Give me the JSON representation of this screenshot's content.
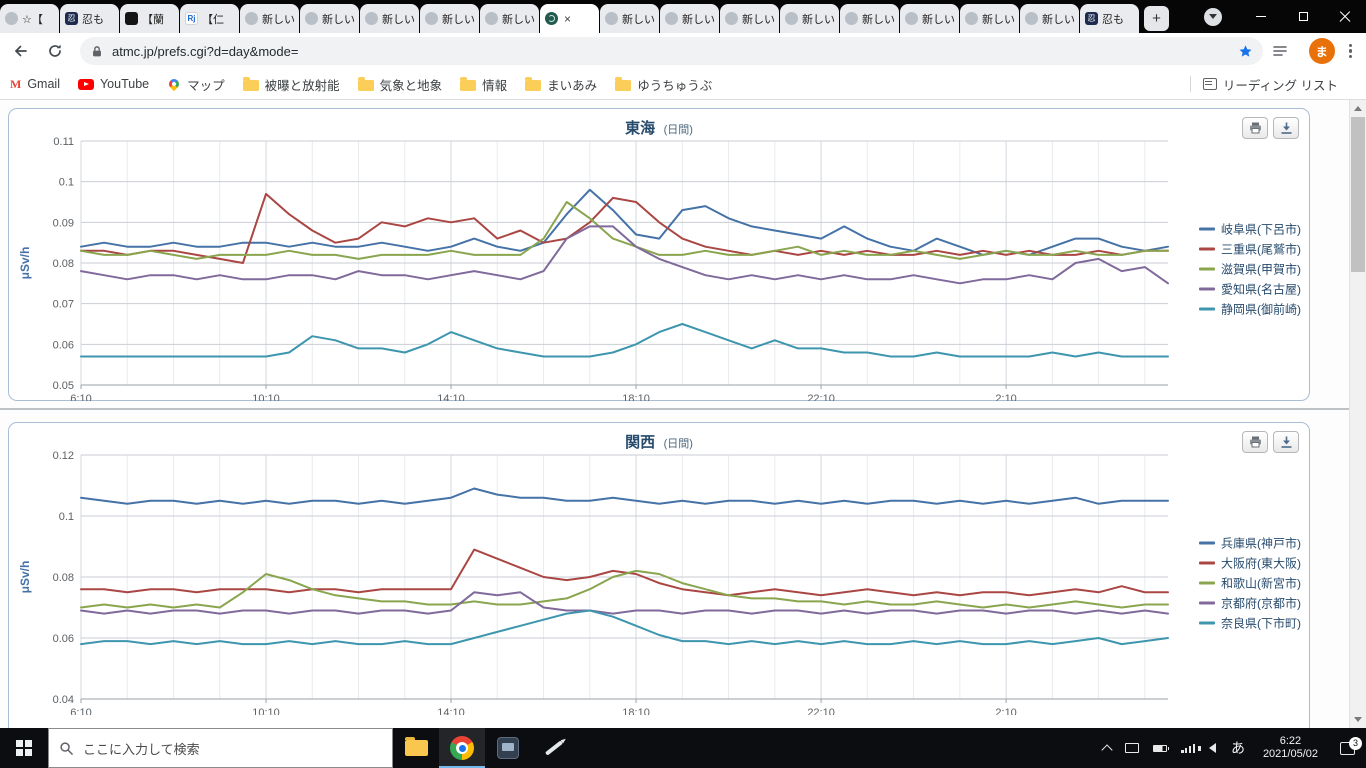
{
  "browser": {
    "tabs": [
      {
        "title": "☆【",
        "icon": "doc"
      },
      {
        "title": "忍も",
        "icon": "ninja"
      },
      {
        "title": "【蘭",
        "icon": "black"
      },
      {
        "title": "【仁",
        "icon": "rj"
      },
      {
        "title": "新しいタ",
        "icon": "doc"
      },
      {
        "title": "新しいタ",
        "icon": "doc"
      },
      {
        "title": "新しいタ",
        "icon": "doc"
      },
      {
        "title": "新しいタ",
        "icon": "doc"
      },
      {
        "title": "新しいタ",
        "icon": "doc"
      },
      {
        "title": "",
        "icon": "atmc",
        "active": true
      },
      {
        "title": "新しいタ",
        "icon": "doc"
      },
      {
        "title": "新しいタ",
        "icon": "doc"
      },
      {
        "title": "新しいタ",
        "icon": "doc"
      },
      {
        "title": "新しいタ",
        "icon": "doc"
      },
      {
        "title": "新しいタ",
        "icon": "doc"
      },
      {
        "title": "新しいタ",
        "icon": "doc"
      },
      {
        "title": "新しいタ",
        "icon": "doc"
      },
      {
        "title": "新しいタ",
        "icon": "doc"
      },
      {
        "title": "忍も",
        "icon": "ninja"
      }
    ],
    "new_tab_button": "+",
    "toolbar": {
      "url": "atmc.jp/prefs.cgi?d=day&mode=",
      "avatar_letter": "ま"
    },
    "bookmarks": [
      {
        "label": "Gmail",
        "icon": "gmail"
      },
      {
        "label": "YouTube",
        "icon": "youtube"
      },
      {
        "label": "マップ",
        "icon": "maps"
      },
      {
        "label": "被曝と放射能",
        "icon": "folder"
      },
      {
        "label": "気象と地象",
        "icon": "folder"
      },
      {
        "label": "情報",
        "icon": "folder"
      },
      {
        "label": "まいあみ",
        "icon": "folder"
      },
      {
        "label": "ゆうちゅうぶ",
        "icon": "folder"
      }
    ],
    "reading_list_label": "リーディング リスト"
  },
  "chart_data": [
    {
      "type": "line",
      "title": "東海",
      "subtitle": "(日間)",
      "ylabel": "μSv/h",
      "ylim": [
        0.05,
        0.11
      ],
      "ytick": 0.01,
      "xspan": 23.5,
      "xstep": 0.5,
      "xticks": [
        0,
        4,
        8,
        12,
        16,
        20
      ],
      "xticklabels": [
        "6:10",
        "10:10",
        "14:10",
        "18:10",
        "22:10",
        "2:10"
      ],
      "grid": true,
      "legend_position": "right",
      "series": [
        {
          "name": "岐阜県(下呂市)",
          "color": "#4572A7",
          "values": [
            0.084,
            0.085,
            0.084,
            0.084,
            0.085,
            0.084,
            0.084,
            0.085,
            0.085,
            0.084,
            0.085,
            0.084,
            0.084,
            0.085,
            0.084,
            0.083,
            0.084,
            0.086,
            0.084,
            0.083,
            0.085,
            0.092,
            0.098,
            0.093,
            0.087,
            0.086,
            0.093,
            0.094,
            0.091,
            0.089,
            0.088,
            0.087,
            0.086,
            0.089,
            0.086,
            0.084,
            0.083,
            0.086,
            0.084,
            0.082,
            0.083,
            0.082,
            0.084,
            0.086,
            0.086,
            0.084,
            0.083,
            0.084
          ]
        },
        {
          "name": "三重県(尾鷲市)",
          "color": "#AA4643",
          "values": [
            0.083,
            0.083,
            0.082,
            0.083,
            0.083,
            0.082,
            0.081,
            0.08,
            0.097,
            0.092,
            0.088,
            0.085,
            0.086,
            0.09,
            0.089,
            0.091,
            0.09,
            0.091,
            0.086,
            0.088,
            0.085,
            0.086,
            0.09,
            0.096,
            0.095,
            0.09,
            0.086,
            0.084,
            0.083,
            0.082,
            0.083,
            0.082,
            0.083,
            0.082,
            0.083,
            0.082,
            0.082,
            0.083,
            0.082,
            0.083,
            0.082,
            0.083,
            0.082,
            0.082,
            0.083,
            0.082,
            0.083,
            0.083
          ]
        },
        {
          "name": "滋賀県(甲賀市)",
          "color": "#89A54E",
          "values": [
            0.083,
            0.082,
            0.082,
            0.083,
            0.082,
            0.081,
            0.082,
            0.082,
            0.082,
            0.083,
            0.082,
            0.082,
            0.081,
            0.082,
            0.082,
            0.082,
            0.083,
            0.082,
            0.082,
            0.082,
            0.086,
            0.095,
            0.091,
            0.086,
            0.084,
            0.082,
            0.082,
            0.083,
            0.082,
            0.082,
            0.083,
            0.084,
            0.082,
            0.083,
            0.082,
            0.082,
            0.083,
            0.082,
            0.081,
            0.082,
            0.083,
            0.082,
            0.082,
            0.083,
            0.082,
            0.082,
            0.083,
            0.083
          ]
        },
        {
          "name": "愛知県(名古屋)",
          "color": "#80699B",
          "values": [
            0.078,
            0.077,
            0.076,
            0.077,
            0.077,
            0.076,
            0.077,
            0.076,
            0.076,
            0.077,
            0.077,
            0.076,
            0.078,
            0.077,
            0.077,
            0.076,
            0.077,
            0.078,
            0.077,
            0.076,
            0.078,
            0.086,
            0.089,
            0.089,
            0.084,
            0.081,
            0.079,
            0.077,
            0.076,
            0.077,
            0.076,
            0.077,
            0.076,
            0.077,
            0.076,
            0.076,
            0.077,
            0.076,
            0.075,
            0.076,
            0.076,
            0.077,
            0.076,
            0.08,
            0.081,
            0.078,
            0.079,
            0.075
          ]
        },
        {
          "name": "静岡県(御前崎)",
          "color": "#3D96AE",
          "values": [
            0.057,
            0.057,
            0.057,
            0.057,
            0.057,
            0.057,
            0.057,
            0.057,
            0.057,
            0.058,
            0.062,
            0.061,
            0.059,
            0.059,
            0.058,
            0.06,
            0.063,
            0.061,
            0.059,
            0.058,
            0.057,
            0.057,
            0.057,
            0.058,
            0.06,
            0.063,
            0.065,
            0.063,
            0.061,
            0.059,
            0.061,
            0.059,
            0.059,
            0.058,
            0.058,
            0.057,
            0.057,
            0.058,
            0.057,
            0.057,
            0.057,
            0.057,
            0.058,
            0.057,
            0.058,
            0.057,
            0.057,
            0.057
          ]
        }
      ]
    },
    {
      "type": "line",
      "title": "関西",
      "subtitle": "(日間)",
      "ylabel": "μSv/h",
      "ylim": [
        0.04,
        0.12
      ],
      "ytick": 0.02,
      "xspan": 23.5,
      "xstep": 0.5,
      "xticks": [
        0,
        4,
        8,
        12,
        16,
        20
      ],
      "xticklabels": [
        "6:10",
        "10:10",
        "14:10",
        "18:10",
        "22:10",
        "2:10"
      ],
      "grid": true,
      "legend_position": "right",
      "series": [
        {
          "name": "兵庫県(神戸市)",
          "color": "#4572A7",
          "values": [
            0.106,
            0.105,
            0.104,
            0.105,
            0.105,
            0.104,
            0.105,
            0.104,
            0.105,
            0.104,
            0.105,
            0.105,
            0.104,
            0.105,
            0.104,
            0.105,
            0.106,
            0.109,
            0.107,
            0.106,
            0.106,
            0.105,
            0.105,
            0.106,
            0.105,
            0.104,
            0.105,
            0.104,
            0.105,
            0.105,
            0.104,
            0.105,
            0.104,
            0.105,
            0.104,
            0.105,
            0.105,
            0.104,
            0.105,
            0.104,
            0.105,
            0.104,
            0.105,
            0.106,
            0.104,
            0.105,
            0.105,
            0.105
          ]
        },
        {
          "name": "大阪府(東大阪)",
          "color": "#AA4643",
          "values": [
            0.076,
            0.076,
            0.075,
            0.076,
            0.076,
            0.075,
            0.076,
            0.076,
            0.076,
            0.075,
            0.076,
            0.076,
            0.075,
            0.076,
            0.076,
            0.076,
            0.076,
            0.089,
            0.086,
            0.083,
            0.08,
            0.079,
            0.08,
            0.082,
            0.081,
            0.078,
            0.076,
            0.075,
            0.074,
            0.075,
            0.076,
            0.075,
            0.074,
            0.075,
            0.076,
            0.075,
            0.074,
            0.075,
            0.074,
            0.075,
            0.075,
            0.074,
            0.075,
            0.076,
            0.075,
            0.077,
            0.075,
            0.075
          ]
        },
        {
          "name": "和歌山(新宮市)",
          "color": "#89A54E",
          "values": [
            0.07,
            0.071,
            0.07,
            0.071,
            0.07,
            0.071,
            0.07,
            0.075,
            0.081,
            0.079,
            0.076,
            0.074,
            0.073,
            0.072,
            0.072,
            0.071,
            0.071,
            0.072,
            0.071,
            0.071,
            0.072,
            0.073,
            0.076,
            0.08,
            0.082,
            0.081,
            0.078,
            0.076,
            0.074,
            0.073,
            0.073,
            0.072,
            0.072,
            0.071,
            0.072,
            0.071,
            0.071,
            0.072,
            0.071,
            0.07,
            0.071,
            0.07,
            0.071,
            0.072,
            0.071,
            0.07,
            0.071,
            0.071
          ]
        },
        {
          "name": "京都府(京都市)",
          "color": "#80699B",
          "values": [
            0.069,
            0.068,
            0.069,
            0.068,
            0.069,
            0.069,
            0.068,
            0.069,
            0.069,
            0.068,
            0.069,
            0.069,
            0.068,
            0.069,
            0.069,
            0.068,
            0.069,
            0.075,
            0.074,
            0.075,
            0.07,
            0.069,
            0.069,
            0.068,
            0.069,
            0.069,
            0.068,
            0.069,
            0.069,
            0.068,
            0.069,
            0.069,
            0.068,
            0.069,
            0.068,
            0.069,
            0.069,
            0.068,
            0.069,
            0.069,
            0.068,
            0.069,
            0.069,
            0.068,
            0.069,
            0.068,
            0.069,
            0.068
          ]
        },
        {
          "name": "奈良県(下市町)",
          "color": "#3D96AE",
          "values": [
            0.058,
            0.059,
            0.059,
            0.058,
            0.059,
            0.058,
            0.059,
            0.058,
            0.058,
            0.059,
            0.058,
            0.059,
            0.058,
            0.058,
            0.059,
            0.058,
            0.058,
            0.06,
            0.062,
            0.064,
            0.066,
            0.068,
            0.069,
            0.067,
            0.064,
            0.061,
            0.059,
            0.059,
            0.058,
            0.059,
            0.058,
            0.059,
            0.058,
            0.059,
            0.058,
            0.058,
            0.059,
            0.058,
            0.059,
            0.058,
            0.058,
            0.059,
            0.058,
            0.059,
            0.06,
            0.058,
            0.059,
            0.06
          ]
        }
      ]
    }
  ],
  "taskbar": {
    "search_placeholder": "ここに入力して検索",
    "ime_indicator": "あ",
    "clock_time": "6:22",
    "clock_date": "2021/05/02",
    "notification_count": "3"
  }
}
